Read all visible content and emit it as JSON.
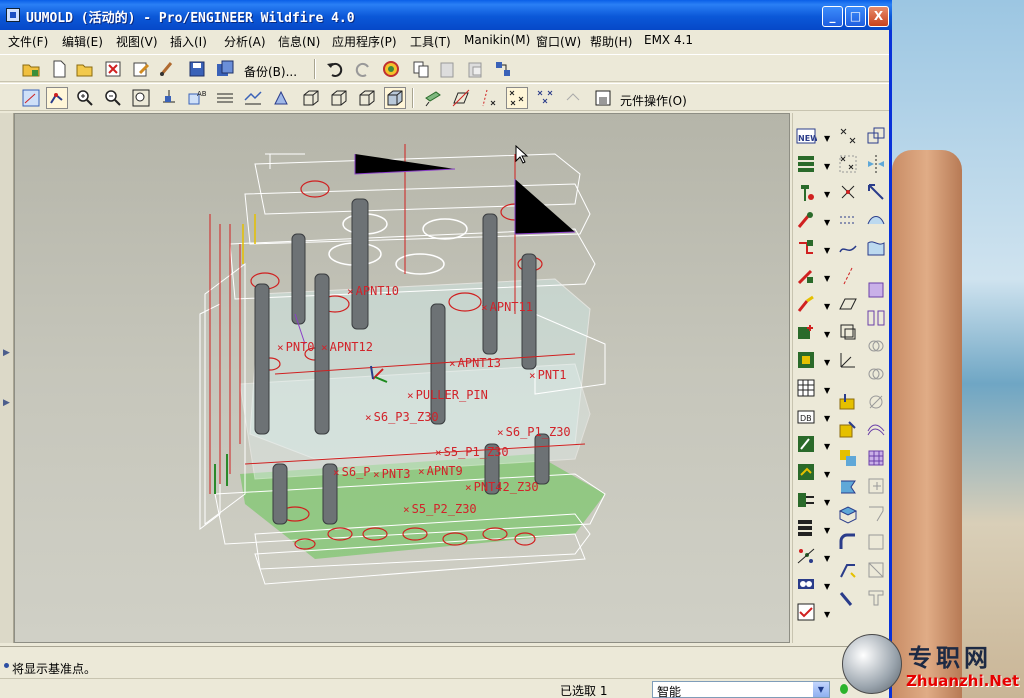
{
  "window": {
    "title": "UUMOLD (活动的) - Pro/ENGINEER Wildfire 4.0",
    "minimize": "_",
    "maximize": "□",
    "close": "X"
  },
  "menu": {
    "items": [
      "文件(F)",
      "编辑(E)",
      "视图(V)",
      "插入(I)",
      "分析(A)",
      "信息(N)",
      "应用程序(P)",
      "工具(T)",
      "Manikin(M)",
      "窗口(W)",
      "帮助(H)",
      "EMX 4.1"
    ]
  },
  "toolbar1": {
    "backup_label": "备份(B)..."
  },
  "toolbar2": {
    "component_ops_label": "元件操作(O)"
  },
  "graphics": {
    "point_labels": [
      "APNT10",
      "APNT11",
      "PNT0",
      "APNT12",
      "APNT13",
      "PNT1",
      "PULLER_PIN",
      "S6_P3_Z30",
      "S6_P1_Z30",
      "S5_P1_Z30",
      "S6_P",
      "PNT3",
      "APNT9",
      "PNT42_Z30",
      "S5_P2_Z30"
    ]
  },
  "status": {
    "message": "将显示基准点。",
    "selected": "已选取 1",
    "filter_value": "智能"
  },
  "watermark": {
    "cn": "专职网",
    "en": "Zhuanzhi.Net"
  }
}
